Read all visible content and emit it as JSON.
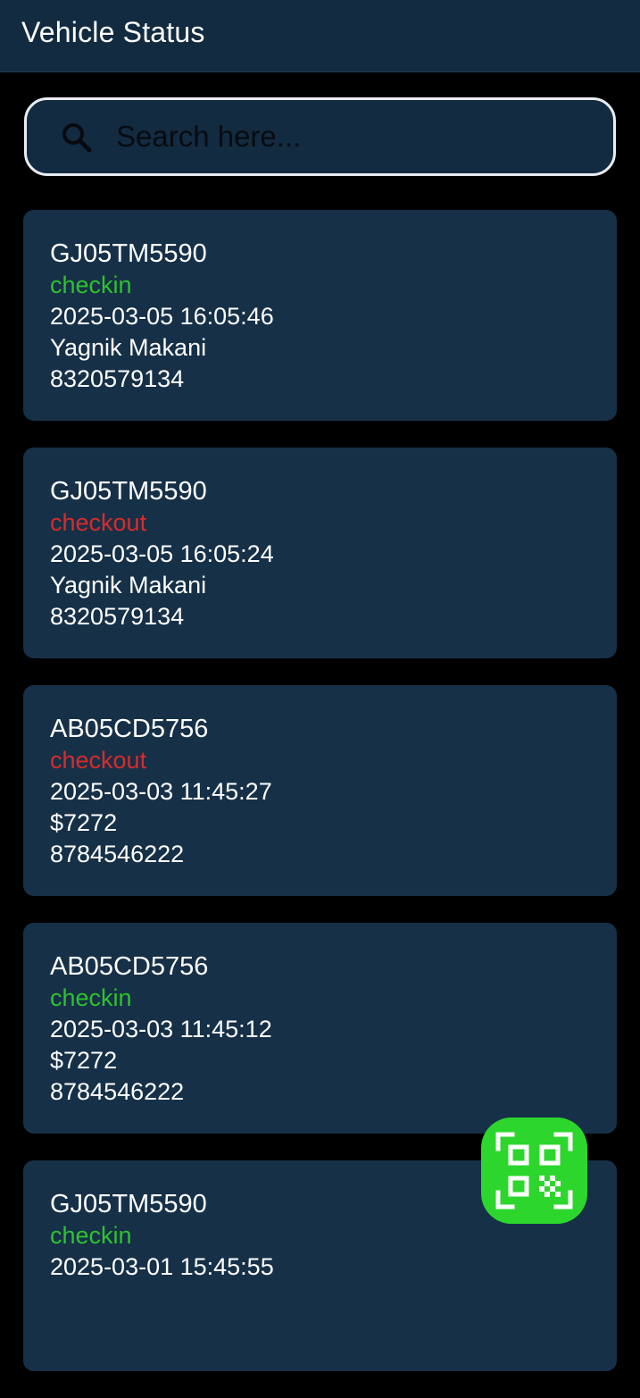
{
  "app_bar": {
    "title": "Vehicle Status"
  },
  "search": {
    "placeholder": "Search here..."
  },
  "records": [
    {
      "plate": "GJ05TM5590",
      "status": "checkin",
      "timestamp": "2025-03-05 16:05:46",
      "detail": "Yagnik Makani",
      "phone": "8320579134"
    },
    {
      "plate": "GJ05TM5590",
      "status": "checkout",
      "timestamp": "2025-03-05 16:05:24",
      "detail": "Yagnik Makani",
      "phone": "8320579134"
    },
    {
      "plate": "AB05CD5756",
      "status": "checkout",
      "timestamp": "2025-03-03 11:45:27",
      "detail": "$7272",
      "phone": "8784546222"
    },
    {
      "plate": "AB05CD5756",
      "status": "checkin",
      "timestamp": "2025-03-03 11:45:12",
      "detail": "$7272",
      "phone": "8784546222"
    },
    {
      "plate": "GJ05TM5590",
      "status": "checkin",
      "timestamp": "2025-03-01 15:45:55",
      "detail": "",
      "phone": ""
    }
  ],
  "colors": {
    "checkin": "#2ec22e",
    "checkout": "#d92b2b",
    "card_bg": "#163048",
    "app_bar_bg": "#132b40",
    "fab_bg": "#2dd62d"
  },
  "fab": {
    "icon": "qr-scan-icon"
  }
}
